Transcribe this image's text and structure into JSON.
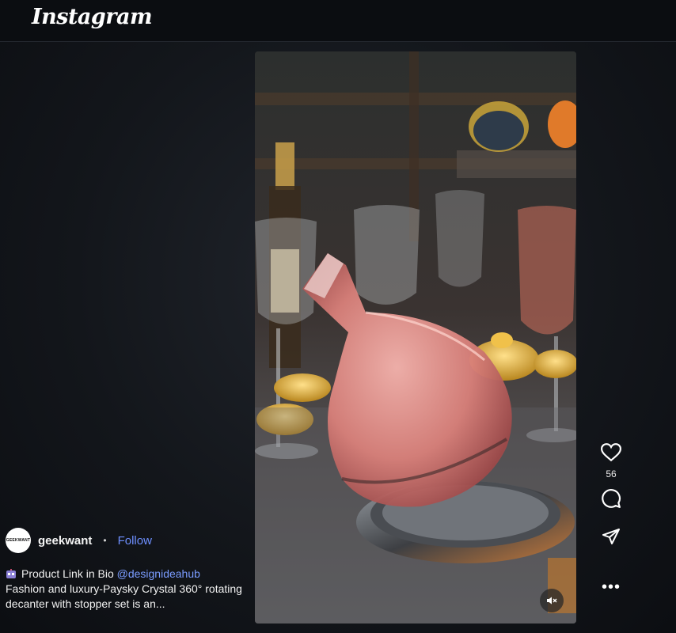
{
  "app": {
    "title": "Instagram"
  },
  "post": {
    "author": {
      "username": "geekwant",
      "avatar_text": "GEEKWANT"
    },
    "separator": "•",
    "follow_label": "Follow",
    "caption": {
      "line1_prefix": "Product Link in Bio",
      "mention": "@designideahub",
      "body": "Fashion and luxury-Paysky Crystal 360° rotating decanter with stopper set is an..."
    },
    "likes": "56",
    "more_label": "•••"
  },
  "icons": {
    "like": "heart-icon",
    "comment": "comment-icon",
    "share": "send-icon",
    "more": "more-options-icon",
    "mute": "speaker-muted-icon",
    "emoji": "robot-emoji-icon"
  },
  "colors": {
    "background": "#0c0f14",
    "link": "#6e8fff",
    "mention": "#7a9cff"
  }
}
